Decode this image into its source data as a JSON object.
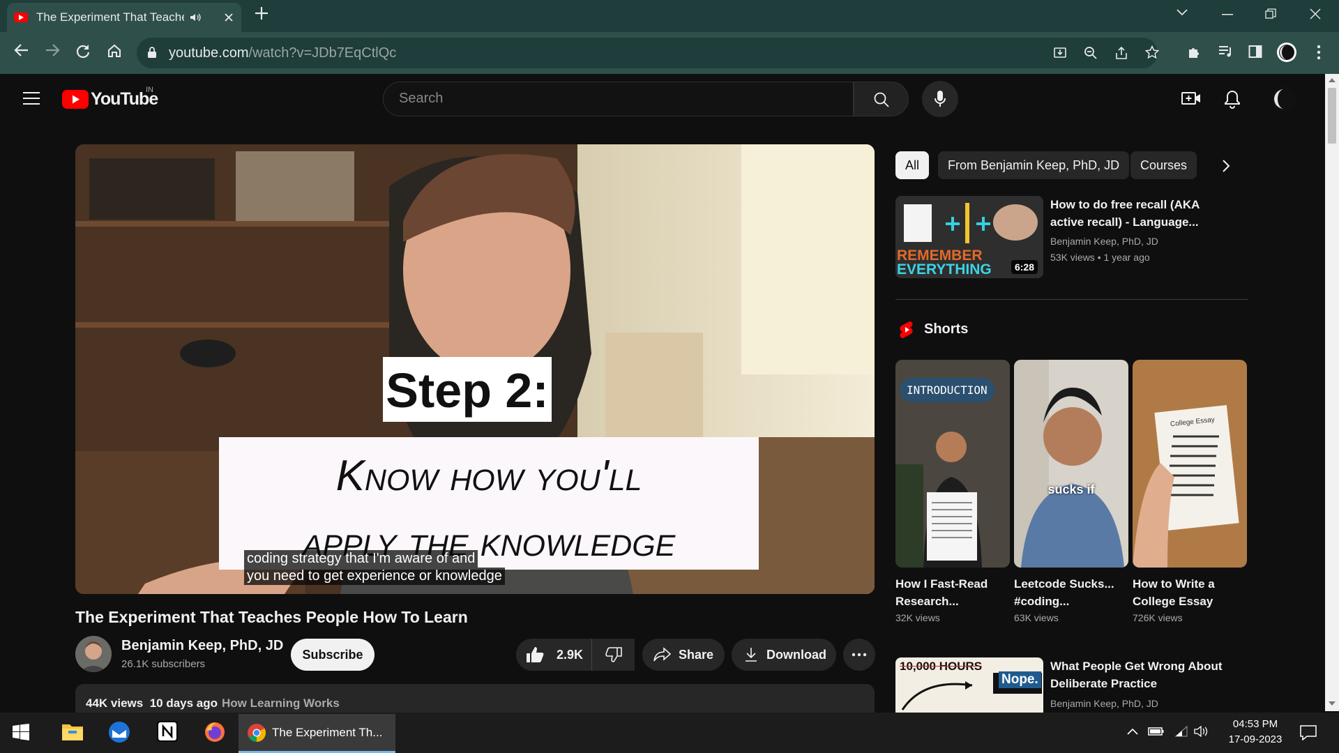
{
  "browser": {
    "tab_title": "The Experiment That Teaches",
    "url_host": "youtube.com",
    "url_path": "/watch?v=JDb7EqCtlQc"
  },
  "youtube": {
    "logo_text": "YouTube",
    "region": "IN",
    "search_placeholder": "Search"
  },
  "video": {
    "overlay_step": "Step 2:",
    "overlay_line1": "Know how you'll",
    "overlay_line2": "apply the knowledge",
    "caption_line1": "coding strategy that I'm aware of and",
    "caption_line2": "you need to get experience or knowledge",
    "title": "The Experiment That Teaches People How To Learn",
    "channel": "Benjamin Keep, PhD, JD",
    "subscribers": "26.1K subscribers",
    "subscribe_label": "Subscribe",
    "likes": "2.9K",
    "share_label": "Share",
    "download_label": "Download",
    "views": "44K views",
    "age": "10 days ago",
    "hashtag": "How Learning Works"
  },
  "sidebar": {
    "chips": [
      "All",
      "From Benjamin Keep, PhD, JD",
      "Courses"
    ],
    "rec1": {
      "title_line1": "How to do free recall (AKA",
      "title_line2": "active recall) - Language...",
      "channel": "Benjamin Keep, PhD, JD",
      "views": "53K views",
      "age": "1 year ago",
      "duration": "6:28",
      "thumb_text1": "REMEMBER",
      "thumb_text2": "EVERYTHING"
    },
    "shorts_heading": "Shorts",
    "shorts": [
      {
        "title1": "How I Fast-Read",
        "title2": "Research...",
        "views": "32K views",
        "thumb_text": "INTRODUCTION"
      },
      {
        "title1": "Leetcode Sucks...",
        "title2": "#coding...",
        "views": "63K views",
        "thumb_text": "sucks if"
      },
      {
        "title1": "How to Write a",
        "title2": "College Essay",
        "views": "726K views",
        "thumb_text": "College Essay"
      }
    ],
    "rec2": {
      "title_line1": "What People Get Wrong About",
      "title_line2": "Deliberate Practice",
      "channel": "Benjamin Keep, PhD, JD",
      "thumb_text1": "10,000 HOURS",
      "thumb_text2": "Nope."
    }
  },
  "taskbar": {
    "chrome_label": "The Experiment Th...",
    "time": "04:53 PM",
    "date": "17-09-2023"
  }
}
